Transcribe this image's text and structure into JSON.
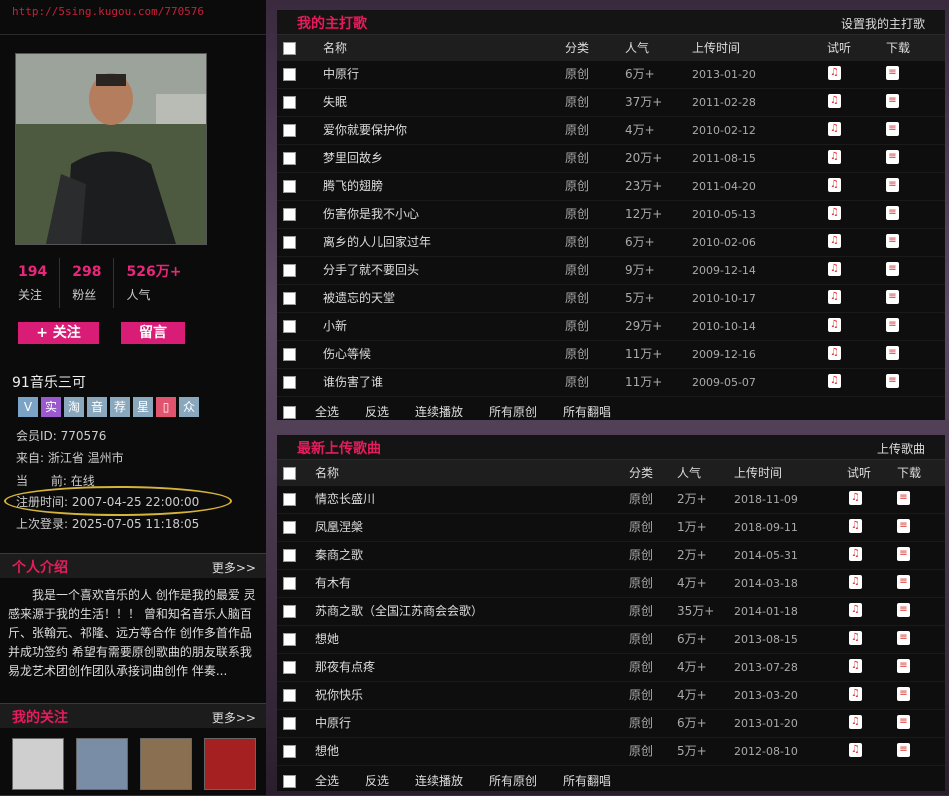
{
  "profile": {
    "url": "http://5sing.kugou.com/770576",
    "stats": [
      {
        "num": "194",
        "label": "关注"
      },
      {
        "num": "298",
        "label": "粉丝"
      },
      {
        "num": "526万+",
        "label": "人气"
      }
    ],
    "follow_button": "+ 关注",
    "message_button": "留言",
    "name": "91音乐三可",
    "badges": [
      "V",
      "实",
      "淘",
      "音",
      "荐",
      "星",
      "▯",
      "众"
    ],
    "member_id": "会员ID:  770576",
    "location": "来自: 浙江省 温州市",
    "current": "当      前: 在线",
    "registered": "注册时间: 2007-04-25 22:00:00",
    "last_login": "上次登录: 2025-07-05 11:18:05"
  },
  "intro": {
    "title": "个人介绍",
    "more": "更多>>",
    "text": "我是一个喜欢音乐的人 创作是我的最爱 灵感来源于我的生活！！！ 曾和知名音乐人脑百斤、张翰元、祁隆、远方等合作 创作多首作品并成功签约 希望有需要原创歌曲的朋友联系我 易龙艺术团创作团队承接词曲创作 伴奏..."
  },
  "follows": {
    "title": "我的关注",
    "more": "更多>>"
  },
  "main_songs": {
    "title": "我的主打歌",
    "action": "设置我的主打歌",
    "headers": {
      "name": "名称",
      "cat": "分类",
      "pop": "人气",
      "date": "上传时间",
      "listen": "试听",
      "download": "下载"
    },
    "rows": [
      {
        "name": "中原行",
        "cat": "原创",
        "pop": "6万+",
        "date": "2013-01-20"
      },
      {
        "name": "失眠",
        "cat": "原创",
        "pop": "37万+",
        "date": "2011-02-28"
      },
      {
        "name": "爱你就要保护你",
        "cat": "原创",
        "pop": "4万+",
        "date": "2010-02-12"
      },
      {
        "name": "梦里回故乡",
        "cat": "原创",
        "pop": "20万+",
        "date": "2011-08-15"
      },
      {
        "name": "腾飞的翅膀",
        "cat": "原创",
        "pop": "23万+",
        "date": "2011-04-20"
      },
      {
        "name": "伤害你是我不小心",
        "cat": "原创",
        "pop": "12万+",
        "date": "2010-05-13"
      },
      {
        "name": "离乡的人儿回家过年",
        "cat": "原创",
        "pop": "6万+",
        "date": "2010-02-06"
      },
      {
        "name": "分手了就不要回头",
        "cat": "原创",
        "pop": "9万+",
        "date": "2009-12-14"
      },
      {
        "name": "被遗忘的天堂",
        "cat": "原创",
        "pop": "5万+",
        "date": "2010-10-17"
      },
      {
        "name": "小新",
        "cat": "原创",
        "pop": "29万+",
        "date": "2010-10-14"
      },
      {
        "name": "伤心等候",
        "cat": "原创",
        "pop": "11万+",
        "date": "2009-12-16"
      },
      {
        "name": "谁伤害了谁",
        "cat": "原创",
        "pop": "11万+",
        "date": "2009-05-07"
      }
    ],
    "footer": [
      "全选",
      "反选",
      "连续播放",
      "所有原创",
      "所有翻唱"
    ]
  },
  "latest_songs": {
    "title": "最新上传歌曲",
    "action": "上传歌曲",
    "headers": {
      "name": "名称",
      "cat": "分类",
      "pop": "人气",
      "date": "上传时间",
      "listen": "试听",
      "download": "下载"
    },
    "rows": [
      {
        "name": "情恋长盛川",
        "cat": "原创",
        "pop": "2万+",
        "date": "2018-11-09"
      },
      {
        "name": "凤凰涅槃",
        "cat": "原创",
        "pop": "1万+",
        "date": "2018-09-11"
      },
      {
        "name": "秦商之歌",
        "cat": "原创",
        "pop": "2万+",
        "date": "2014-05-31"
      },
      {
        "name": "有木有",
        "cat": "原创",
        "pop": "4万+",
        "date": "2014-03-18"
      },
      {
        "name": "苏商之歌（全国江苏商会会歌）",
        "cat": "原创",
        "pop": "35万+",
        "date": "2014-01-18"
      },
      {
        "name": "想她",
        "cat": "原创",
        "pop": "6万+",
        "date": "2013-08-15"
      },
      {
        "name": "那夜有点疼",
        "cat": "原创",
        "pop": "4万+",
        "date": "2013-07-28"
      },
      {
        "name": "祝你快乐",
        "cat": "原创",
        "pop": "4万+",
        "date": "2013-03-20"
      },
      {
        "name": "中原行",
        "cat": "原创",
        "pop": "6万+",
        "date": "2013-01-20"
      },
      {
        "name": "想他",
        "cat": "原创",
        "pop": "5万+",
        "date": "2012-08-10"
      }
    ],
    "footer": [
      "全选",
      "反选",
      "连续播放",
      "所有原创",
      "所有翻唱"
    ]
  },
  "colors": {
    "accent": "#e51c5c",
    "pink_button": "#d91c75",
    "highlight": "#d6b43a"
  }
}
